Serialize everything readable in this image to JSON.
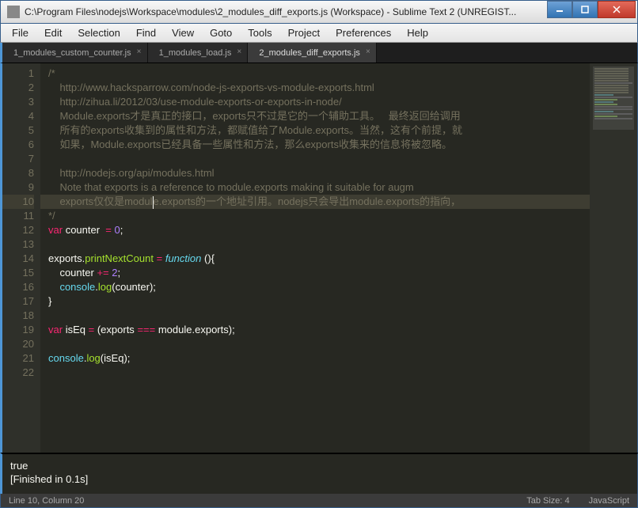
{
  "window": {
    "title": "C:\\Program Files\\nodejs\\Workspace\\modules\\2_modules_diff_exports.js (Workspace) - Sublime Text 2 (UNREGIST..."
  },
  "menu": {
    "items": [
      "File",
      "Edit",
      "Selection",
      "Find",
      "View",
      "Goto",
      "Tools",
      "Project",
      "Preferences",
      "Help"
    ]
  },
  "tabs": [
    {
      "label": "1_modules_custom_counter.js",
      "active": false
    },
    {
      "label": "1_modules_load.js",
      "active": false
    },
    {
      "label": "2_modules_diff_exports.js",
      "active": true
    }
  ],
  "code": {
    "lines": [
      {
        "n": 1,
        "type": "comment",
        "text": "/*"
      },
      {
        "n": 2,
        "type": "comment",
        "text": "    http://www.hacksparrow.com/node-js-exports-vs-module-exports.html"
      },
      {
        "n": 3,
        "type": "comment",
        "text": "    http://zihua.li/2012/03/use-module-exports-or-exports-in-node/"
      },
      {
        "n": 4,
        "type": "comment",
        "text": "    Module.exports才是真正的接口，exports只不过是它的一个辅助工具。   最终返回给调用"
      },
      {
        "n": 5,
        "type": "comment",
        "text": "    所有的exports收集到的属性和方法，都赋值给了Module.exports。当然，这有个前提，就"
      },
      {
        "n": 6,
        "type": "comment",
        "text": "    如果，Module.exports已经具备一些属性和方法，那么exports收集来的信息将被忽略。"
      },
      {
        "n": 7,
        "type": "comment",
        "text": ""
      },
      {
        "n": 8,
        "type": "comment",
        "text": "    http://nodejs.org/api/modules.html"
      },
      {
        "n": 9,
        "type": "comment",
        "text": "    Note that exports is a reference to module.exports making it suitable for augm"
      },
      {
        "n": 10,
        "type": "comment",
        "text": "    exports仅仅是module.exports的一个地址引用。nodejs只会导出module.exports的指向，"
      },
      {
        "n": 11,
        "type": "comment",
        "text": "*/"
      },
      {
        "n": 12,
        "type": "code",
        "html": "<span class='cm-storage'>var</span> <span class='cm-var'>counter</span>  <span class='cm-op'>=</span> <span class='cm-number'>0</span><span class='cm-punc'>;</span>"
      },
      {
        "n": 13,
        "type": "code",
        "html": ""
      },
      {
        "n": 14,
        "type": "code",
        "html": "<span class='cm-var'>exports</span><span class='cm-punc'>.</span><span class='cm-func'>printNextCount</span> <span class='cm-op'>=</span> <span class='cm-keyword'>function</span> <span class='cm-punc'>(){</span>"
      },
      {
        "n": 15,
        "type": "code",
        "html": "    <span class='cm-var'>counter</span> <span class='cm-op'>+=</span> <span class='cm-number'>2</span><span class='cm-punc'>;</span>"
      },
      {
        "n": 16,
        "type": "code",
        "html": "    <span class='cm-builtin'>console</span><span class='cm-punc'>.</span><span class='cm-func'>log</span><span class='cm-punc'>(</span><span class='cm-var'>counter</span><span class='cm-punc'>);</span>"
      },
      {
        "n": 17,
        "type": "code",
        "html": "<span class='cm-punc'>}</span>"
      },
      {
        "n": 18,
        "type": "code",
        "html": ""
      },
      {
        "n": 19,
        "type": "code",
        "html": "<span class='cm-storage'>var</span> <span class='cm-var'>isEq</span> <span class='cm-op'>=</span> <span class='cm-punc'>(</span><span class='cm-var'>exports</span> <span class='cm-op'>===</span> <span class='cm-var'>module</span><span class='cm-punc'>.</span><span class='cm-var'>exports</span><span class='cm-punc'>);</span>"
      },
      {
        "n": 20,
        "type": "code",
        "html": ""
      },
      {
        "n": 21,
        "type": "code",
        "html": "<span class='cm-builtin'>console</span><span class='cm-punc'>.</span><span class='cm-func'>log</span><span class='cm-punc'>(</span><span class='cm-var'>isEq</span><span class='cm-punc'>);</span>"
      },
      {
        "n": 22,
        "type": "code",
        "html": ""
      }
    ],
    "current_line": 10
  },
  "output": {
    "line1": "true",
    "line2": "[Finished in 0.1s]"
  },
  "status": {
    "position": "Line 10, Column 20",
    "tab_size": "Tab Size: 4",
    "language": "JavaScript"
  }
}
